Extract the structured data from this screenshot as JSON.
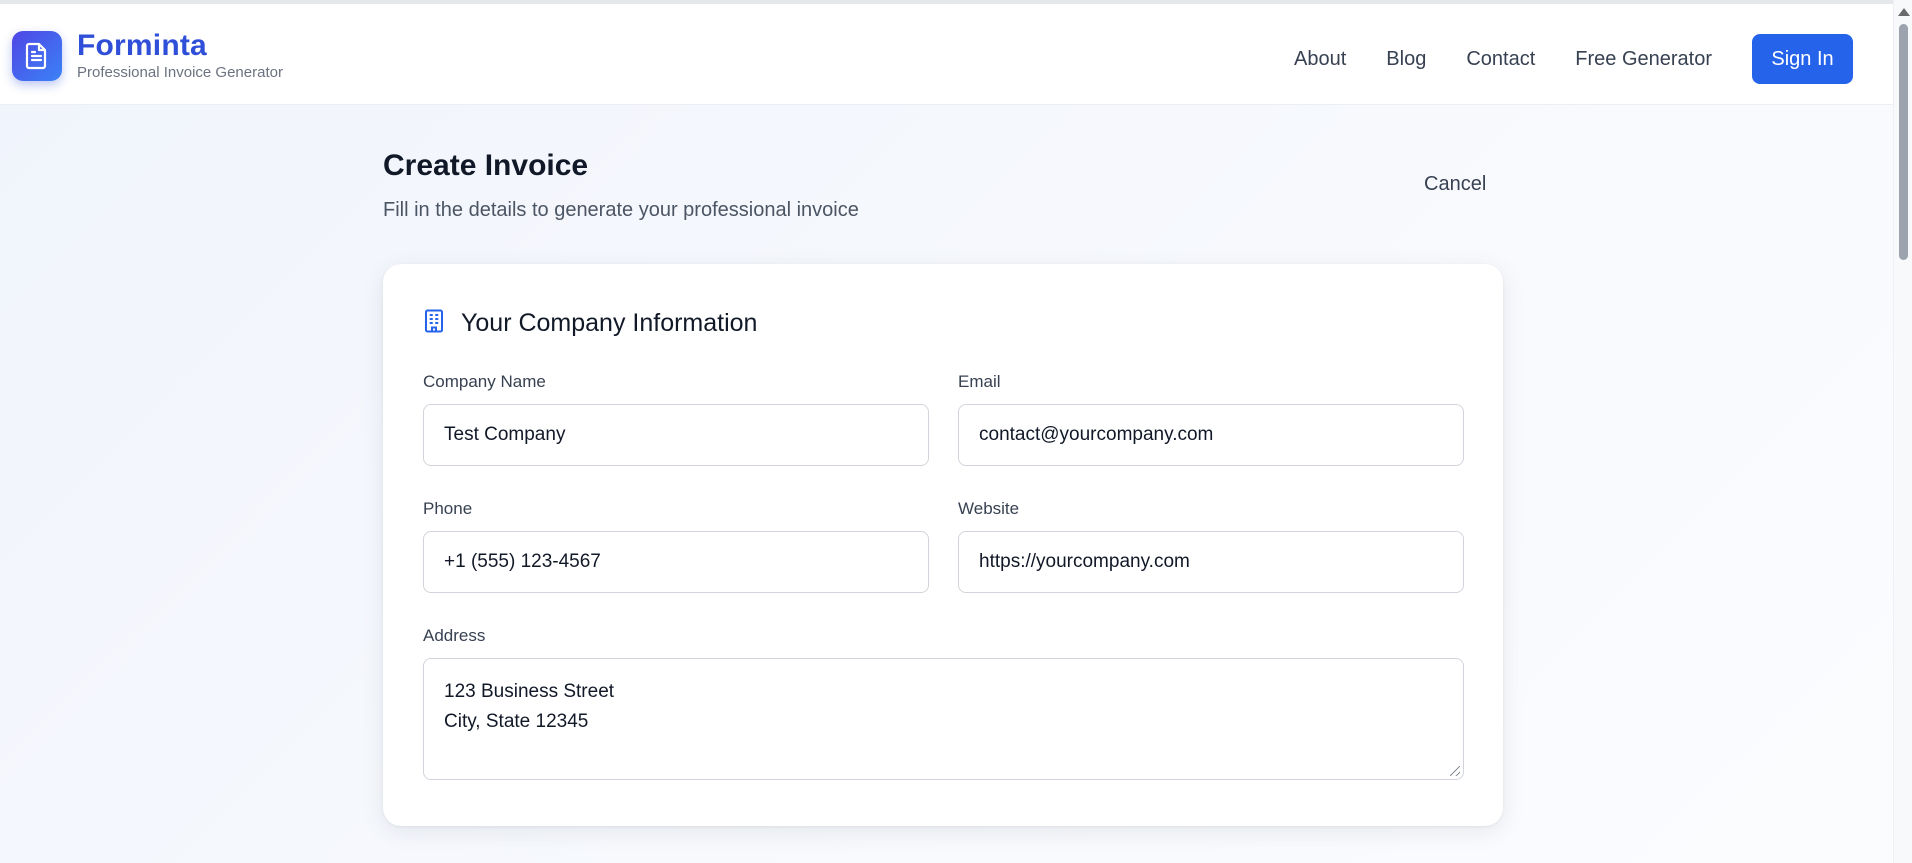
{
  "brand": {
    "name": "Forminta",
    "tagline": "Professional Invoice Generator",
    "icon": "document-icon"
  },
  "nav": {
    "about": "About",
    "blog": "Blog",
    "contact": "Contact",
    "free_generator": "Free Generator",
    "sign_in": "Sign In"
  },
  "page": {
    "title": "Create Invoice",
    "subtitle": "Fill in the details to generate your professional invoice",
    "cancel": "Cancel"
  },
  "company_section": {
    "title": "Your Company Information",
    "icon": "building-icon",
    "company_name": {
      "label": "Company Name",
      "value": "Test Company"
    },
    "email": {
      "label": "Email",
      "value": "contact@yourcompany.com"
    },
    "phone": {
      "label": "Phone",
      "value": "+1 (555) 123-4567"
    },
    "website": {
      "label": "Website",
      "value": "https://yourcompany.com"
    },
    "address": {
      "label": "Address",
      "line1": "123 Business Street",
      "line2": "City, State 12345"
    }
  },
  "colors": {
    "brand": "#2f4fd8",
    "accent": "#2563eb",
    "logo_gradient_start": "#4f46e5",
    "logo_gradient_end": "#3b82f6"
  }
}
